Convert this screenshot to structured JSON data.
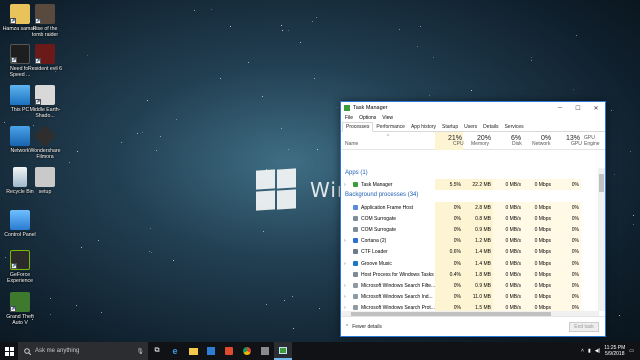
{
  "desktop": {
    "icons": [
      {
        "label": "Hamza samani"
      },
      {
        "label": "Rise of the tomb raider"
      },
      {
        "label": "Need for Speed ..."
      },
      {
        "label": "Resident evil 6"
      },
      {
        "label": "This PC"
      },
      {
        "label": "Middle Earth-Shado..."
      },
      {
        "label": "Network"
      },
      {
        "label": "Wondershare Filmora"
      },
      {
        "label": "Recycle Bin"
      },
      {
        "label": "setup"
      },
      {
        "label": "Control Panel"
      },
      {
        "label": "GeForce Experience"
      },
      {
        "label": "Grand Theft Auto V"
      }
    ],
    "wallpaper_text": "Windo"
  },
  "task_manager": {
    "title": "Task Manager",
    "menu": [
      "File",
      "Options",
      "View"
    ],
    "tabs": [
      "Processes",
      "Performance",
      "App history",
      "Startup",
      "Users",
      "Details",
      "Services"
    ],
    "active_tab": "Processes",
    "columns": {
      "name": "Name",
      "cpu": {
        "pct": "21%",
        "label": "CPU"
      },
      "memory": {
        "pct": "20%",
        "label": "Memory"
      },
      "disk": {
        "pct": "6%",
        "label": "Disk"
      },
      "network": {
        "pct": "0%",
        "label": "Network"
      },
      "gpu": {
        "pct": "13%",
        "label": "GPU"
      },
      "gpu_engine": {
        "label": "GPU Engine"
      }
    },
    "sections": {
      "apps": "Apps (1)",
      "background": "Background processes (34)"
    },
    "app_rows": [
      {
        "name": "Task Manager",
        "cpu": "5.5%",
        "mem": "22.2 MB",
        "disk": "0 MB/s",
        "net": "0 Mbps",
        "gpu": "0%"
      }
    ],
    "bg_rows": [
      {
        "name": "Application Frame Host",
        "cpu": "0%",
        "mem": "2.8 MB",
        "disk": "0 MB/s",
        "net": "0 Mbps",
        "gpu": "0%"
      },
      {
        "name": "COM Surrogate",
        "cpu": "0%",
        "mem": "0.8 MB",
        "disk": "0 MB/s",
        "net": "0 Mbps",
        "gpu": "0%"
      },
      {
        "name": "COM Surrogate",
        "cpu": "0%",
        "mem": "0.9 MB",
        "disk": "0 MB/s",
        "net": "0 Mbps",
        "gpu": "0%"
      },
      {
        "name": "Cortana (2)",
        "cpu": "0%",
        "mem": "1.2 MB",
        "disk": "0 MB/s",
        "net": "0 Mbps",
        "gpu": "0%"
      },
      {
        "name": "CTF Loader",
        "cpu": "0.6%",
        "mem": "1.4 MB",
        "disk": "0 MB/s",
        "net": "0 Mbps",
        "gpu": "0%"
      },
      {
        "name": "Groove Music",
        "cpu": "0%",
        "mem": "1.4 MB",
        "disk": "0 MB/s",
        "net": "0 Mbps",
        "gpu": "0%"
      },
      {
        "name": "Host Process for Windows Tasks",
        "cpu": "0.4%",
        "mem": "1.8 MB",
        "disk": "0 MB/s",
        "net": "0 Mbps",
        "gpu": "0%"
      },
      {
        "name": "Microsoft Windows Search Filte...",
        "cpu": "0%",
        "mem": "0.9 MB",
        "disk": "0 MB/s",
        "net": "0 Mbps",
        "gpu": "0%"
      },
      {
        "name": "Microsoft Windows Search Ind...",
        "cpu": "0%",
        "mem": "11.0 MB",
        "disk": "0 MB/s",
        "net": "0 Mbps",
        "gpu": "0%"
      },
      {
        "name": "Microsoft Windows Search Prot...",
        "cpu": "0%",
        "mem": "1.5 MB",
        "disk": "0 MB/s",
        "net": "0 Mbps",
        "gpu": "0%"
      }
    ],
    "footer": {
      "fewer_details": "Fewer details",
      "end_task": "End task"
    }
  },
  "taskbar": {
    "search_placeholder": "Ask me anything",
    "clock_time": "11:25 PM",
    "clock_date": "5/9/2018"
  }
}
